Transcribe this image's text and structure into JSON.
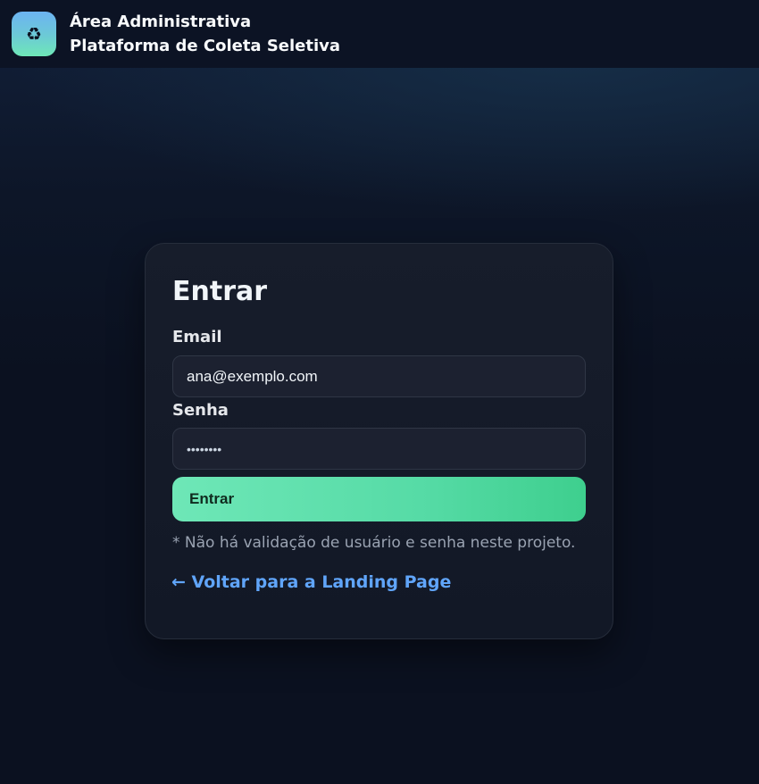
{
  "header": {
    "logo_icon": "recycle-icon",
    "logo_glyph": "♻",
    "title": "Área Administrativa",
    "subtitle": "Plataforma de Coleta Seletiva"
  },
  "login": {
    "heading": "Entrar",
    "email_label": "Email",
    "email_value": "ana@exemplo.com",
    "password_label": "Senha",
    "password_value": "••••••••",
    "submit_label": "Entrar",
    "note": "* Não há validação de usuário e senha neste projeto.",
    "back_link": "← Voltar para a Landing Page"
  },
  "colors": {
    "accent_green": "#6ee7b7",
    "link_blue": "#60a5fa",
    "background": "#0b1120"
  }
}
